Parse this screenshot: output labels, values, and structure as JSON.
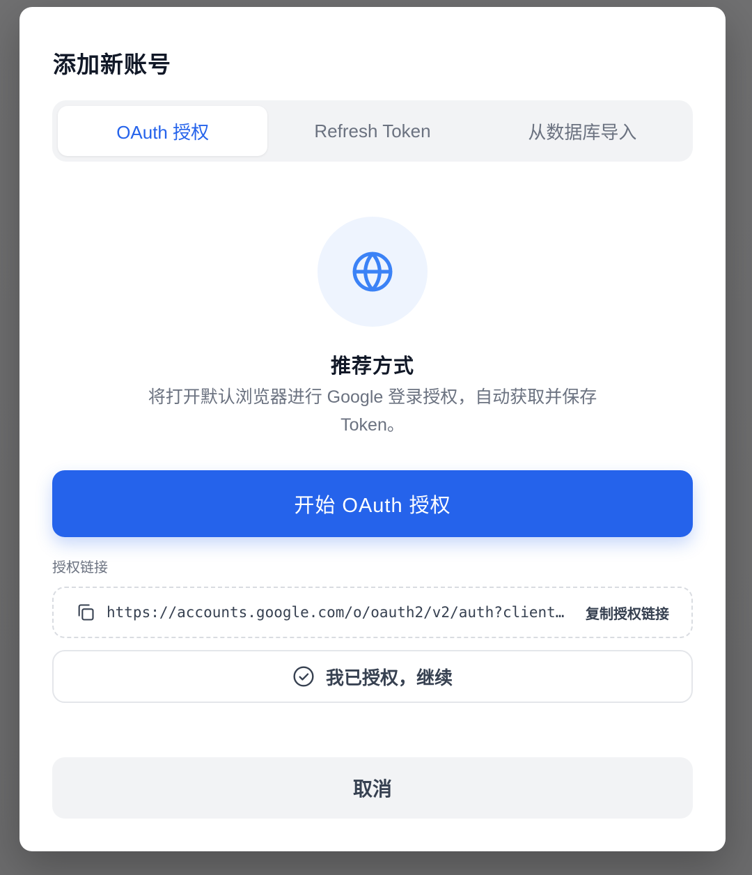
{
  "modal": {
    "title": "添加新账号"
  },
  "tabs": [
    {
      "label": "OAuth 授权",
      "active": true
    },
    {
      "label": "Refresh Token",
      "active": false
    },
    {
      "label": "从数据库导入",
      "active": false
    }
  ],
  "oauth": {
    "icon": "globe-icon",
    "title": "推荐方式",
    "description": "将打开默认浏览器进行 Google 登录授权，自动获取并保存 Token。",
    "start_button": "开始 OAuth 授权",
    "link_label": "授权链接",
    "link_url": "https://accounts.google.com/o/oauth2/v2/auth?client_id",
    "copy_link_button": "复制授权链接",
    "continue_button": "我已授权，继续"
  },
  "footer": {
    "cancel_button": "取消"
  },
  "colors": {
    "accent": "#2563eb",
    "accent_soft": "#eef4fe",
    "tab_bg": "#f2f3f5",
    "text_primary": "#111827",
    "text_secondary": "#6b7280"
  }
}
